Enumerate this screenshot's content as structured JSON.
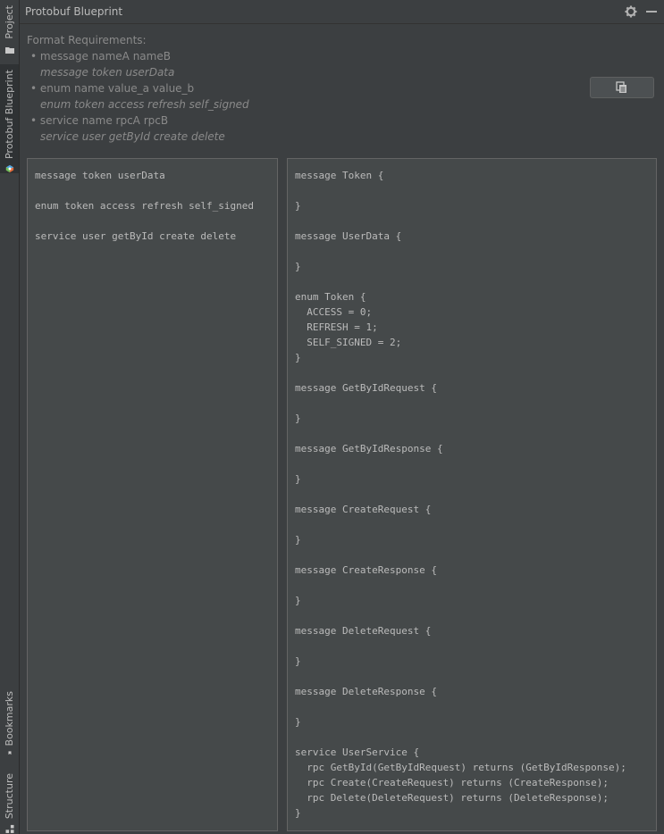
{
  "sidebar": {
    "tabs": [
      {
        "label": "Project",
        "icon": "folder-icon"
      },
      {
        "label": "Protobuf Blueprint",
        "icon": "blueprint-icon",
        "active": true
      },
      {
        "label": "Bookmarks",
        "icon": "bookmark-icon"
      },
      {
        "label": "Structure",
        "icon": "structure-icon"
      }
    ]
  },
  "header": {
    "title": "Protobuf Blueprint",
    "icons": [
      "gear-icon",
      "minimize-icon"
    ]
  },
  "requirements": {
    "title": "Format Requirements:",
    "items": [
      {
        "bullet": "• message nameA nameB",
        "example": "message token userData"
      },
      {
        "bullet": "• enum name value_a value_b",
        "example": "enum token access refresh self_signed"
      },
      {
        "bullet": "• service name rpcA rpcB",
        "example": "service user getById create delete"
      }
    ]
  },
  "copy_button": {
    "icon": "copy-icon"
  },
  "input_text": [
    "message token userData",
    "",
    "enum token access refresh self_signed",
    "",
    "service user getById create delete"
  ],
  "output_text": [
    "message Token {",
    "",
    "}",
    "",
    "message UserData {",
    "",
    "}",
    "",
    "enum Token {",
    "  ACCESS = 0;",
    "  REFRESH = 1;",
    "  SELF_SIGNED = 2;",
    "}",
    "",
    "message GetByIdRequest {",
    "",
    "}",
    "",
    "message GetByIdResponse {",
    "",
    "}",
    "",
    "message CreateRequest {",
    "",
    "}",
    "",
    "message CreateResponse {",
    "",
    "}",
    "",
    "message DeleteRequest {",
    "",
    "}",
    "",
    "message DeleteResponse {",
    "",
    "}",
    "",
    "service UserService {",
    "  rpc GetById(GetByIdRequest) returns (GetByIdResponse);",
    "  rpc Create(CreateRequest) returns (CreateResponse);",
    "  rpc Delete(DeleteRequest) returns (DeleteResponse);",
    "}"
  ]
}
